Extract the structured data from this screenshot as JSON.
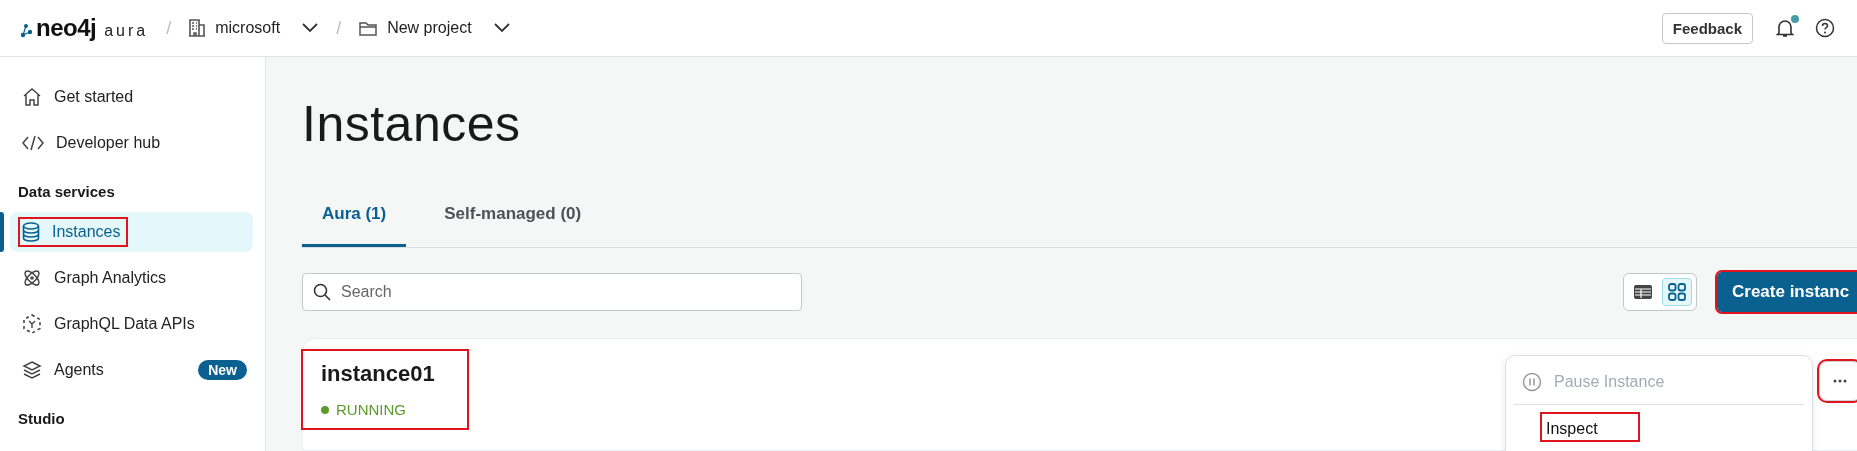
{
  "header": {
    "logo": {
      "brand": "neo4j",
      "product": "aura"
    },
    "breadcrumbs": [
      {
        "separator": "/",
        "kind": "org",
        "label": "microsoft"
      },
      {
        "separator": "/",
        "kind": "project",
        "label": "New project"
      }
    ],
    "feedback": "Feedback",
    "notifications": {
      "unread": true
    }
  },
  "sidebar": {
    "sections": [
      {
        "items": [
          {
            "kind": "home",
            "label": "Get started",
            "selected": false,
            "annotated": false
          },
          {
            "kind": "code",
            "label": "Developer hub",
            "selected": false,
            "annotated": false
          }
        ]
      },
      {
        "title": "Data services",
        "items": [
          {
            "kind": "database",
            "label": "Instances",
            "selected": true,
            "annotated": true
          },
          {
            "kind": "atom",
            "label": "Graph Analytics",
            "selected": false,
            "annotated": false
          },
          {
            "kind": "graphql",
            "label": "GraphQL Data APIs",
            "selected": false,
            "annotated": false
          },
          {
            "kind": "layers",
            "label": "Agents",
            "selected": false,
            "annotated": false,
            "badge": "New"
          }
        ]
      },
      {
        "title": "Studio"
      }
    ]
  },
  "page": {
    "title": "Instances",
    "tabs": [
      {
        "label": "Aura (1)",
        "selected": true
      },
      {
        "label": "Self-managed (0)",
        "selected": false
      }
    ],
    "search": {
      "placeholder": "Search"
    },
    "view_toggle": [
      {
        "kind": "table",
        "selected": false
      },
      {
        "kind": "grid",
        "selected": true
      }
    ],
    "create_button": {
      "label": "Create instanc",
      "annotated": true
    }
  },
  "instances": [
    {
      "name": "instance01",
      "status": "RUNNING",
      "color": "#5b9a2c",
      "annotated": true,
      "more_button": {
        "annotated": true
      },
      "menu": [
        {
          "kind": "pause",
          "label": "Pause Instance",
          "disabled": true,
          "annotated": false
        },
        {
          "kind": "plain",
          "label": "Inspect",
          "disabled": false,
          "annotated": true
        }
      ]
    }
  ]
}
